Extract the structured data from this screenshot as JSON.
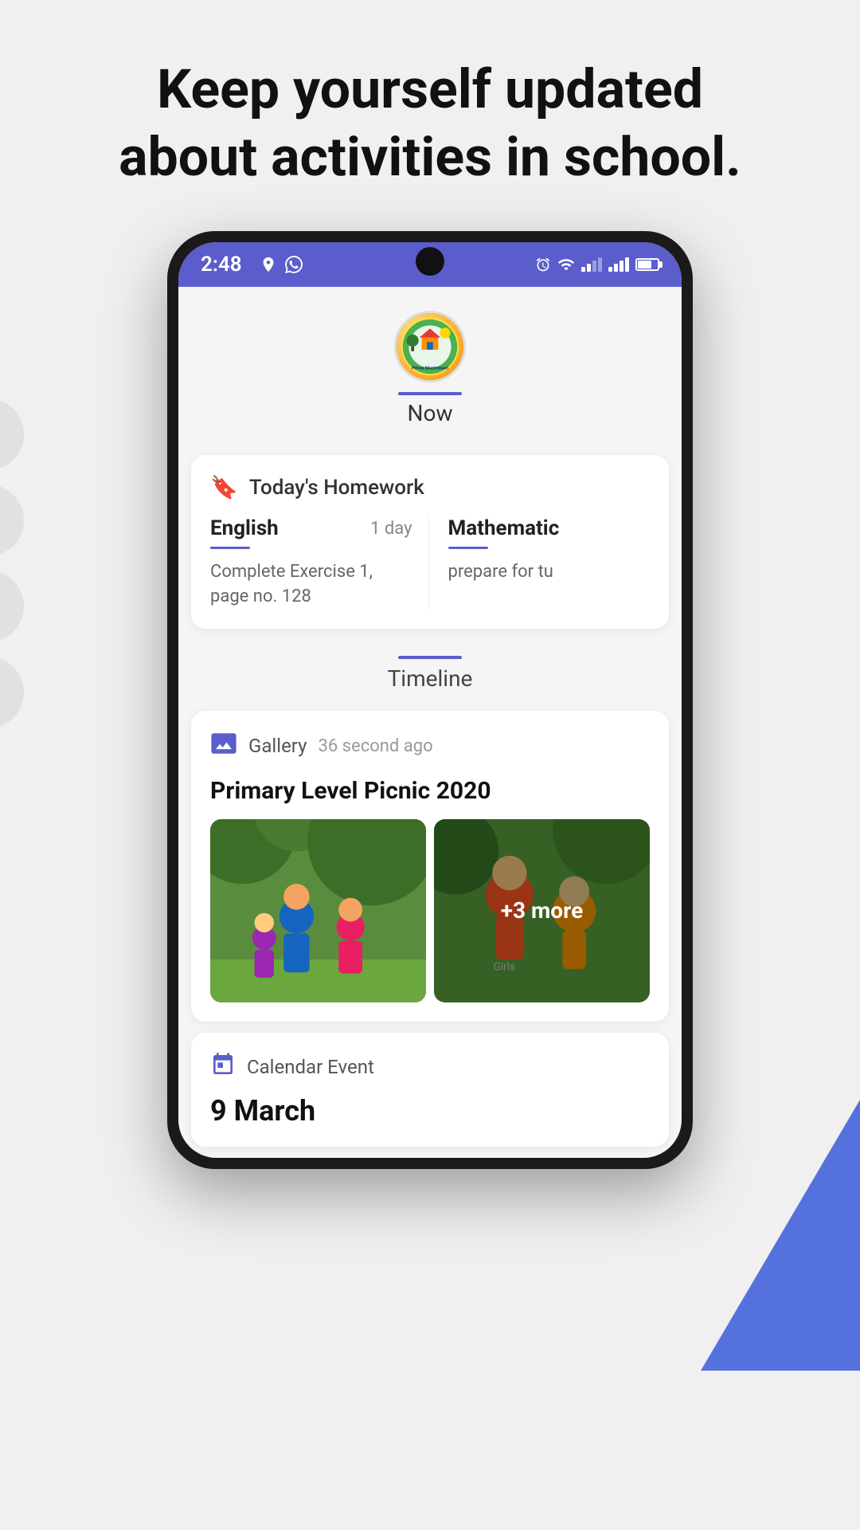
{
  "page": {
    "headline_line1": "Keep yourself updated",
    "headline_line2": "about activities in school."
  },
  "status_bar": {
    "time": "2:48",
    "alarm_icon": "alarm",
    "wifi_icon": "wifi",
    "signal_icon": "signal",
    "battery_icon": "battery"
  },
  "app": {
    "tabs": [
      {
        "label": "Now",
        "active": true
      },
      {
        "label": "Timeline",
        "active": false
      }
    ]
  },
  "homework": {
    "section_title": "Today's Homework",
    "subjects": [
      {
        "name": "English",
        "due": "1 day",
        "description": "Complete Exercise 1, page no. 128"
      },
      {
        "name": "Mathematic",
        "due": "",
        "description": "prepare for tu"
      }
    ]
  },
  "timeline_tab": {
    "label": "Timeline"
  },
  "gallery_post": {
    "type": "Gallery",
    "time": "36 second ago",
    "title": "Primary Level Picnic 2020",
    "more_count": "+3 more"
  },
  "calendar_post": {
    "type": "Calendar Event",
    "date": "9 March"
  }
}
